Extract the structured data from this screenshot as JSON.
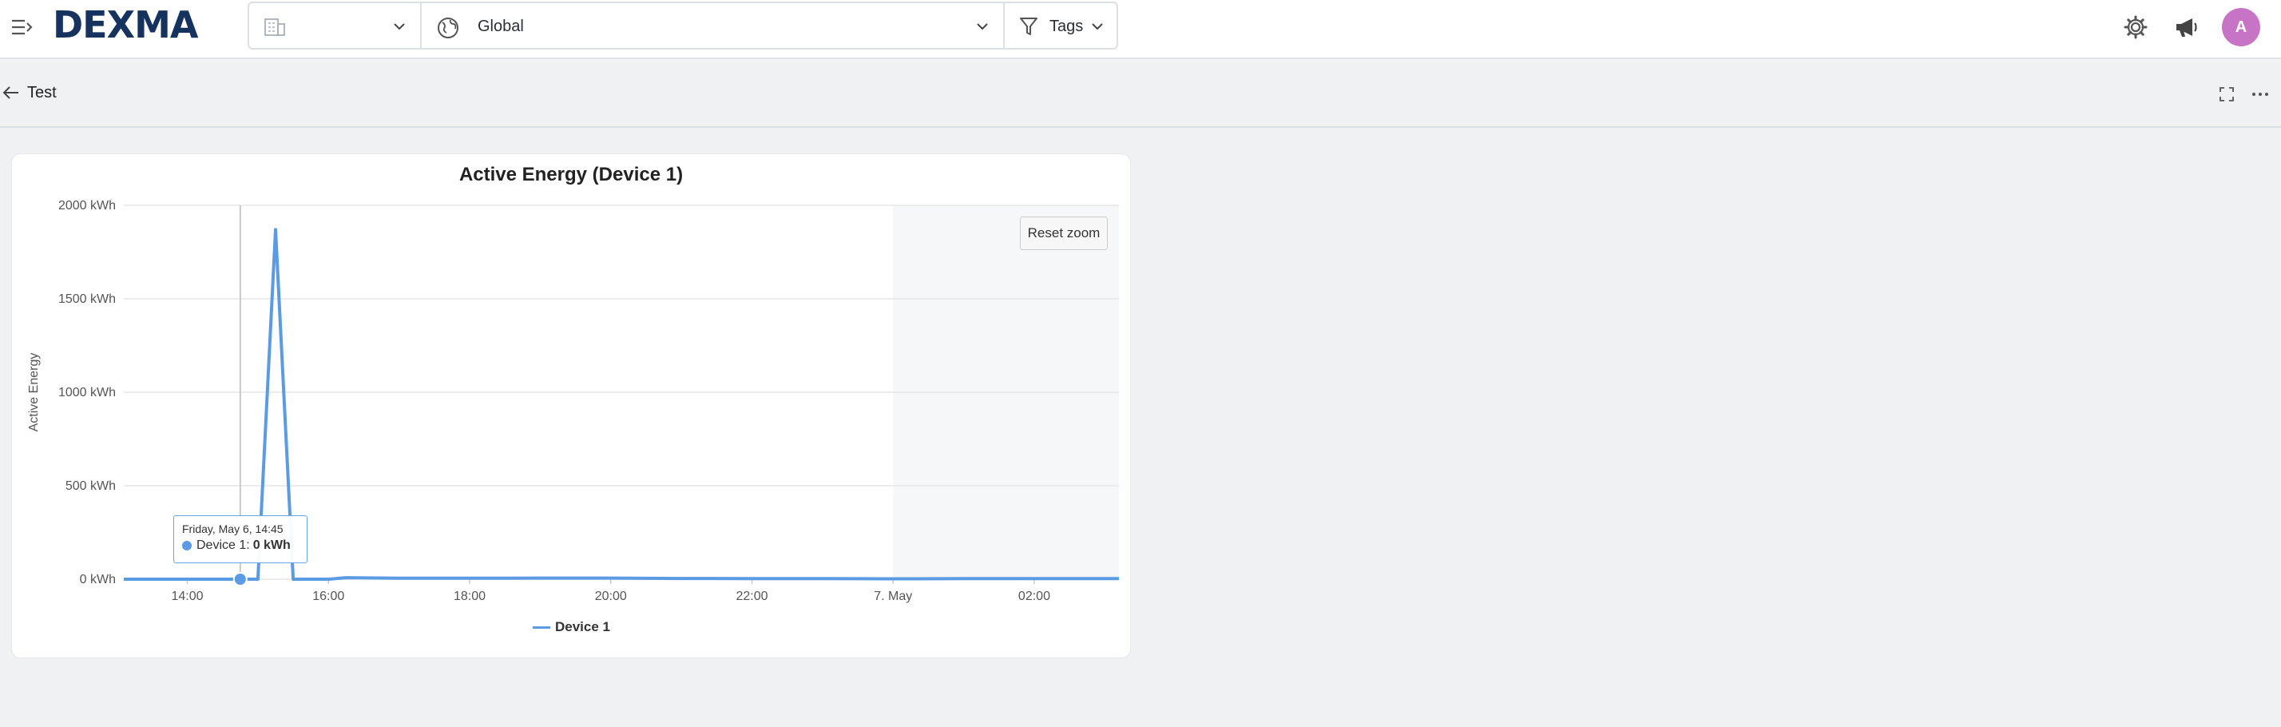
{
  "topbar": {
    "logo": "DEXMA",
    "building_selector": {
      "label": ""
    },
    "location_selector": {
      "label": "Global"
    },
    "tags_filter": {
      "label": "Tags"
    },
    "avatar_initial": "A"
  },
  "page": {
    "title": "Test"
  },
  "widget": {
    "reset_zoom_label": "Reset zoom",
    "tooltip": {
      "date": "Friday, May 6, 14:45",
      "series": "Device 1",
      "value": "0 kWh"
    }
  },
  "chart_data": {
    "type": "line",
    "title": "Active Energy (Device 1)",
    "ylabel": "Active Energy",
    "xlabel": "",
    "y_unit": "kWh",
    "ylim": [
      0,
      2000
    ],
    "y_ticks": [
      "0 kWh",
      "500 kWh",
      "1000 kWh",
      "1500 kWh",
      "2000 kWh"
    ],
    "x_ticks": [
      "14:00",
      "16:00",
      "18:00",
      "20:00",
      "22:00",
      "7. May",
      "02:00"
    ],
    "x_range_hours": [
      13.1,
      27.2
    ],
    "shaded_from_hour": 24,
    "legend": "bottom-center",
    "series": [
      {
        "name": "Device 1",
        "color": "#5b9be4",
        "points": [
          [
            13.1,
            0
          ],
          [
            14.75,
            0
          ],
          [
            15.0,
            0
          ],
          [
            15.25,
            1870
          ],
          [
            15.5,
            0
          ],
          [
            16.0,
            0
          ],
          [
            16.25,
            8
          ],
          [
            17.0,
            5
          ],
          [
            18.0,
            5
          ],
          [
            19.0,
            6
          ],
          [
            20.0,
            6
          ],
          [
            21.0,
            4
          ],
          [
            22.0,
            3
          ],
          [
            23.0,
            3
          ],
          [
            24.0,
            2
          ],
          [
            25.0,
            3
          ],
          [
            26.0,
            3
          ],
          [
            27.2,
            3
          ]
        ]
      }
    ],
    "hover_hour": 14.75
  }
}
